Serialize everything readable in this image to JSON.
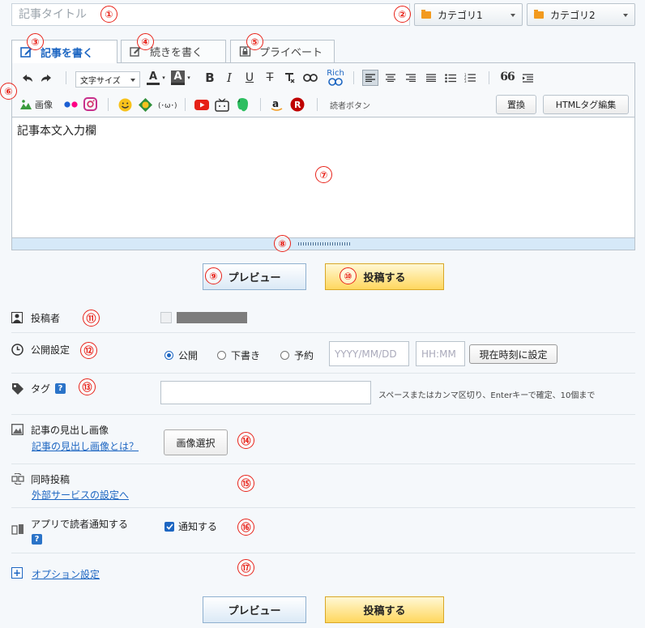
{
  "title_placeholder": "記事タイトル",
  "categories": [
    "カテゴリ1",
    "カテゴリ2"
  ],
  "tabs": [
    "記事を書く",
    "続きを書く",
    "プライベート"
  ],
  "toolbar": {
    "font_size": "文字サイズ",
    "text_color": "A",
    "bg_color": "A",
    "bold": "B",
    "italic": "I",
    "underline": "U",
    "strike": "T",
    "rich": "Rich",
    "quote": "66",
    "image_label": "画像",
    "reader_button": "読者ボタン",
    "replace": "置換",
    "html_edit": "HTMLタグ編集",
    "kaomoji": "(･ω･)"
  },
  "body_text": "記事本文入力欄",
  "buttons": {
    "preview": "プレビュー",
    "post": "投稿する"
  },
  "author": {
    "label": "投稿者"
  },
  "publish": {
    "label": "公開設定",
    "options": [
      "公開",
      "下書き",
      "予約"
    ],
    "selected": "公開",
    "date_placeholder": "YYYY/MM/DD",
    "time_placeholder": "HH:MM",
    "now_button": "現在時刻に設定"
  },
  "tag": {
    "label": "タグ",
    "help": "?",
    "hint": "スペースまたはカンマ区切り、Enterキーで確定、10個まで"
  },
  "header_image": {
    "label": "記事の見出し画像",
    "link": "記事の見出し画像とは？",
    "button": "画像選択"
  },
  "crosspost": {
    "label": "同時投稿",
    "link": "外部サービスの設定へ"
  },
  "notify": {
    "label": "アプリで読者通知する",
    "help": "?",
    "checkbox_label": "通知する",
    "checked": true
  },
  "options": {
    "plus": "+",
    "label": "オプション設定"
  },
  "markers": [
    "①",
    "②",
    "③",
    "④",
    "⑤",
    "⑥",
    "⑦",
    "⑧",
    "⑨",
    "⑩",
    "⑪",
    "⑫",
    "⑬",
    "⑭",
    "⑮",
    "⑯",
    "⑰"
  ]
}
